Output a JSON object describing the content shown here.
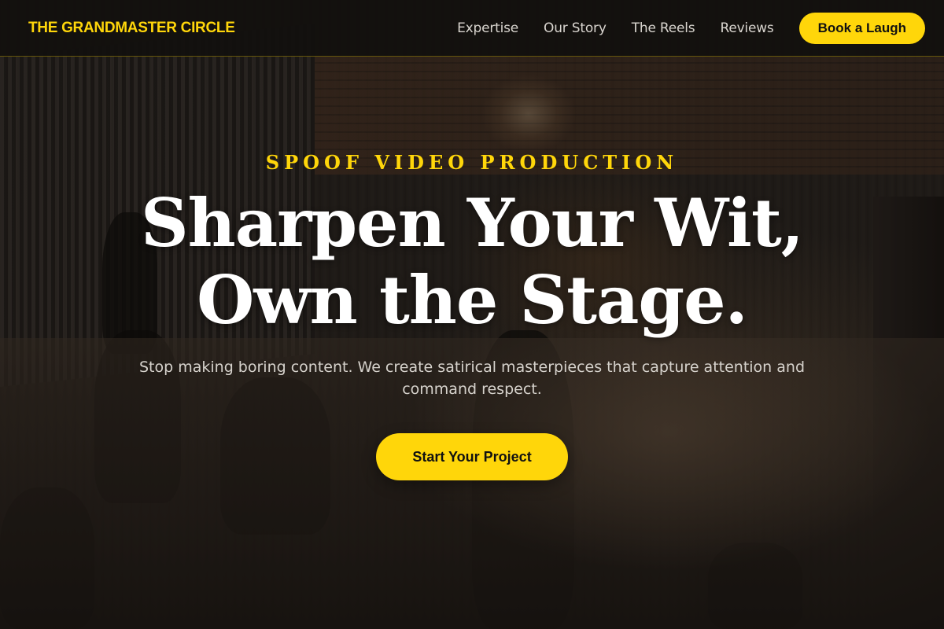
{
  "header": {
    "brand": "THE GRANDMASTER CIRCLE",
    "nav": [
      "Expertise",
      "Our Story",
      "The Reels",
      "Reviews"
    ],
    "cta_label": "Book a Laugh"
  },
  "hero": {
    "eyebrow": "SPOOF VIDEO PRODUCTION",
    "headline_line1": "Sharpen Your Wit,",
    "headline_line2": "Own the Stage.",
    "subtext": "Stop making boring content. We create satirical masterpieces that capture attention and command respect.",
    "cta_label": "Start Your Project",
    "background_image": "film-set-background"
  },
  "colors": {
    "accent": "#FFD60A",
    "header_bg": "#12100E",
    "text_light": "#FFFFFF"
  }
}
